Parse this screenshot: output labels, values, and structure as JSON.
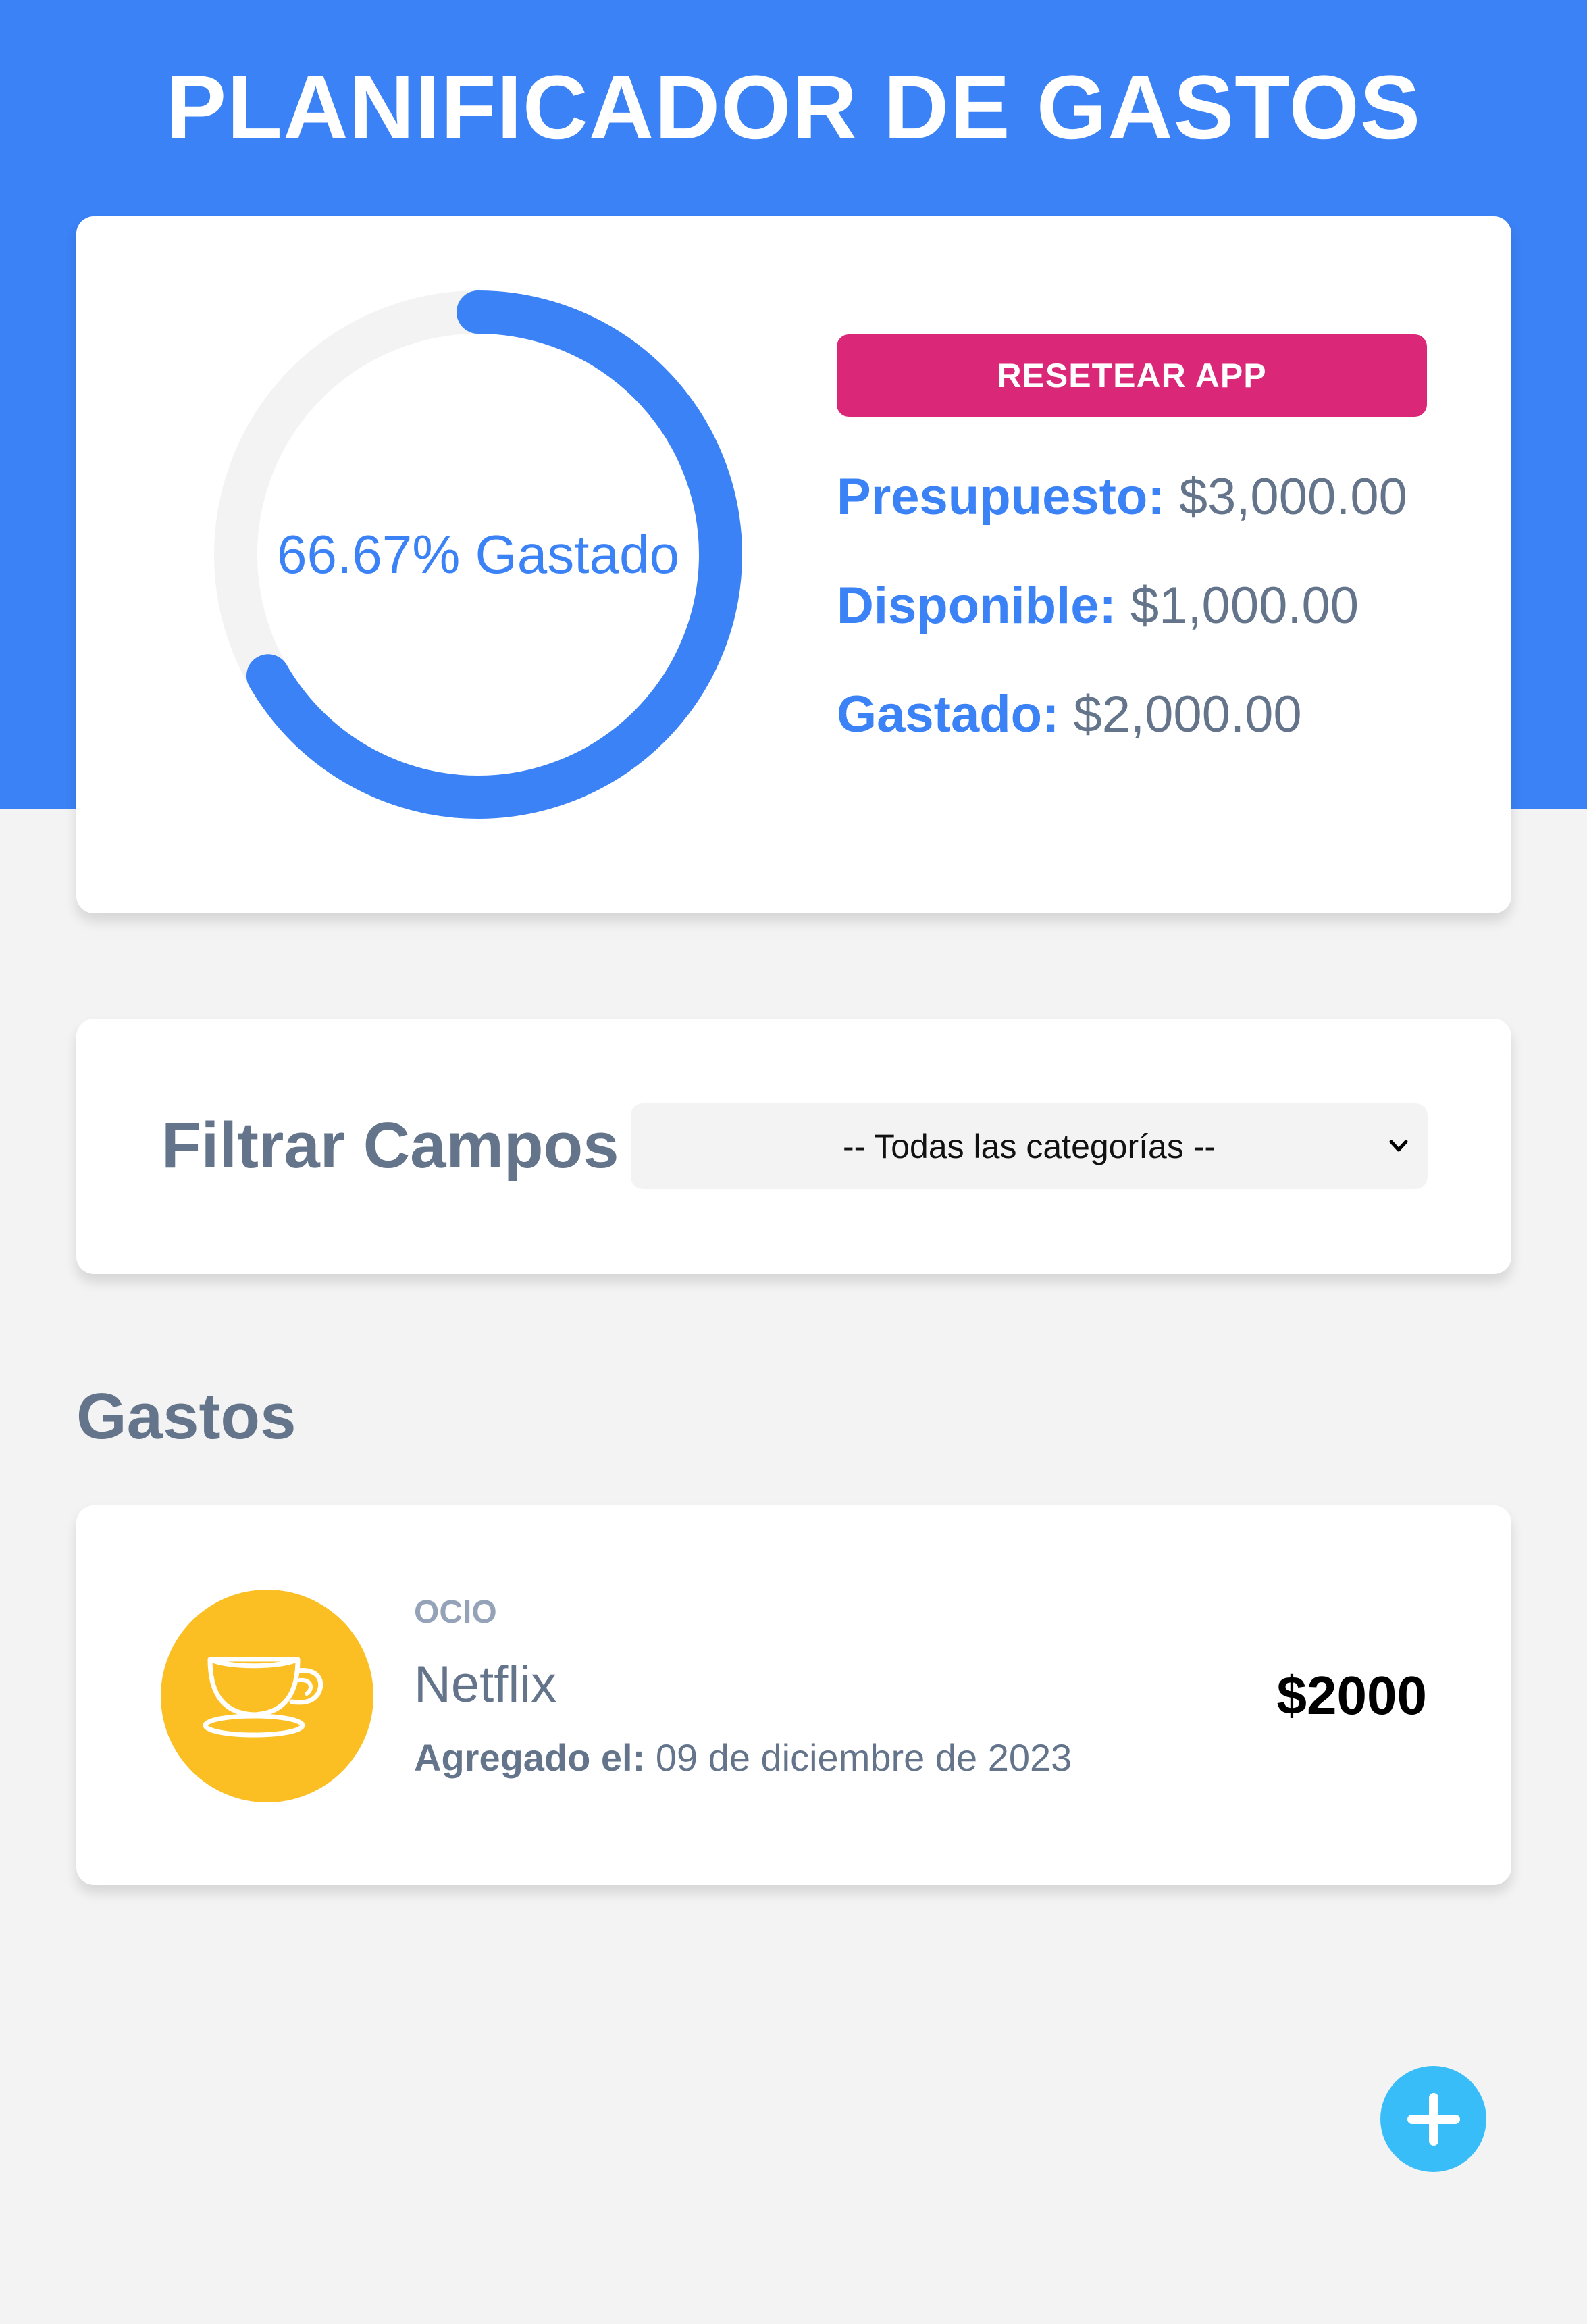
{
  "header": {
    "title": "PLANIFICADOR DE GASTOS",
    "background_color": "#3b82f6"
  },
  "budget": {
    "percent_spent": 66.67,
    "progress_label": "66.67% Gastado",
    "reset_button_label": "RESETEAR APP",
    "reset_button_color": "#db2777",
    "stats": {
      "budget_label": "Presupuesto:",
      "budget_value": "$3,000.00",
      "available_label": "Disponible:",
      "available_value": "$1,000.00",
      "spent_label": "Gastado:",
      "spent_value": "$2,000.00"
    }
  },
  "filter": {
    "label": "Filtrar Campos",
    "selected_option": "-- Todas las categorías --",
    "caret_icon": "chevron-down-icon"
  },
  "expenses": {
    "section_title": "Gastos",
    "items": [
      {
        "category": "OCIO",
        "name": "Netflix",
        "date_label": "Agregado el:",
        "date_value": "09 de diciembre de 2023",
        "amount": "$2000",
        "icon": "coffee-cup-icon",
        "icon_color": "#fbbf24"
      }
    ]
  },
  "fab": {
    "icon": "plus-icon",
    "color": "#38bdf8"
  }
}
